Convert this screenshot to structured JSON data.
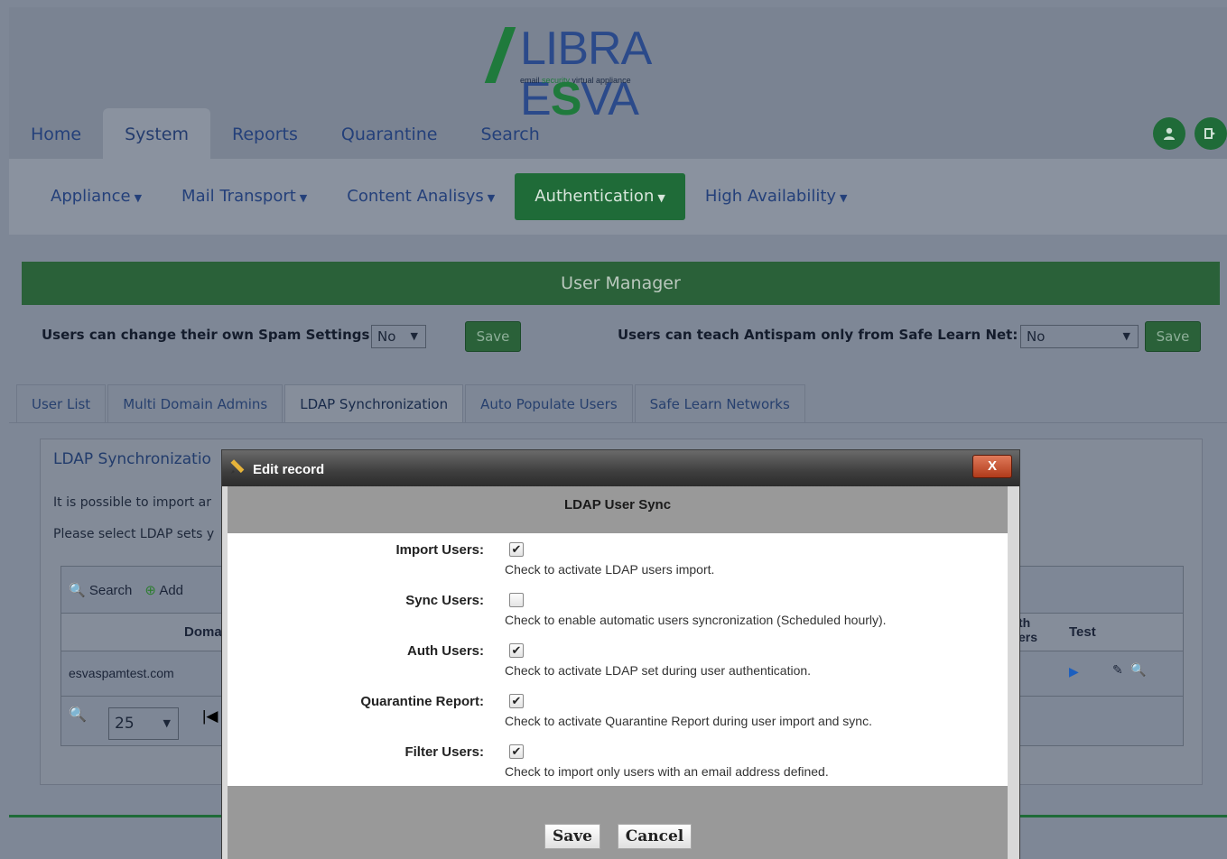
{
  "brand": {
    "name_part1": "LIBRA E",
    "name_bold": "S",
    "name_part2": "VA",
    "tagline_pre": "email ",
    "tagline_green": "security",
    "tagline_post": " virtual appliance"
  },
  "main_tabs": [
    "Home",
    "System",
    "Reports",
    "Quarantine",
    "Search"
  ],
  "active_main_tab": "System",
  "sub_nav": [
    "Appliance",
    "Mail Transport",
    "Content Analisys",
    "Authentication",
    "High Availability"
  ],
  "active_sub_nav": "Authentication",
  "user_manager": {
    "title": "User Manager",
    "spam_settings_label": "Users can change their own Spam Settings:",
    "spam_settings_value": "No",
    "save_label": "Save",
    "safe_learn_label": "Users can teach Antispam only from Safe Learn Net:",
    "safe_learn_value": "No"
  },
  "sub_tabs": [
    "User List",
    "Multi Domain Admins",
    "LDAP Synchronization",
    "Auto Populate Users",
    "Safe Learn Networks"
  ],
  "active_sub_tab": "LDAP Synchronization",
  "ldap_panel": {
    "title": "LDAP Synchronizatio",
    "text1": "It is possible to import ar",
    "text2": "Please select LDAP sets y",
    "toolbar_search": "Search",
    "toolbar_add": "Add",
    "col_domain": "Doma",
    "col_auth_line1": "th",
    "col_auth_line2": "ers",
    "col_test": "Test",
    "row_domain": "esvaspamtest.com",
    "page_size": "25"
  },
  "modal": {
    "title": "Edit record",
    "close_label": "X",
    "subtitle": "LDAP User Sync",
    "fields": [
      {
        "label": "Import Users:",
        "checked": true,
        "help": "Check to activate LDAP users import."
      },
      {
        "label": "Sync Users:",
        "checked": false,
        "help": "Check to enable automatic users syncronization (Scheduled hourly)."
      },
      {
        "label": "Auth Users:",
        "checked": true,
        "help": "Check to activate LDAP set during user authentication."
      },
      {
        "label": "Quarantine Report:",
        "checked": true,
        "help": "Check to activate Quarantine Report during user import and sync."
      },
      {
        "label": "Filter Users:",
        "checked": true,
        "help": "Check to import only users with an email address defined."
      }
    ],
    "save_label": "Save",
    "cancel_label": "Cancel"
  }
}
